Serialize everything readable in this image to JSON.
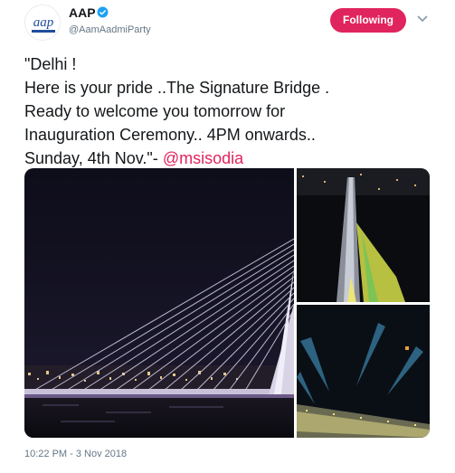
{
  "account": {
    "display_name": "AAP",
    "handle": "@AamAadmiParty",
    "avatar_text": "aap",
    "verified": true
  },
  "follow_button": {
    "label": "Following"
  },
  "tweet": {
    "lines": [
      "\"Delhi !",
      "Here is your pride ..The Signature Bridge .",
      "Ready to welcome you tomorrow for",
      "Inauguration Ceremony.. 4PM onwards..",
      "Sunday, 4th Nov.\"- "
    ],
    "mention": "@msisodia"
  },
  "timestamp": "10:22 PM - 3 Nov 2018",
  "colors": {
    "accent": "#e0245e",
    "verified": "#1da1f2",
    "muted": "#657786"
  },
  "icons": {
    "verified": "verified-badge-icon",
    "caret": "chevron-down-icon"
  }
}
